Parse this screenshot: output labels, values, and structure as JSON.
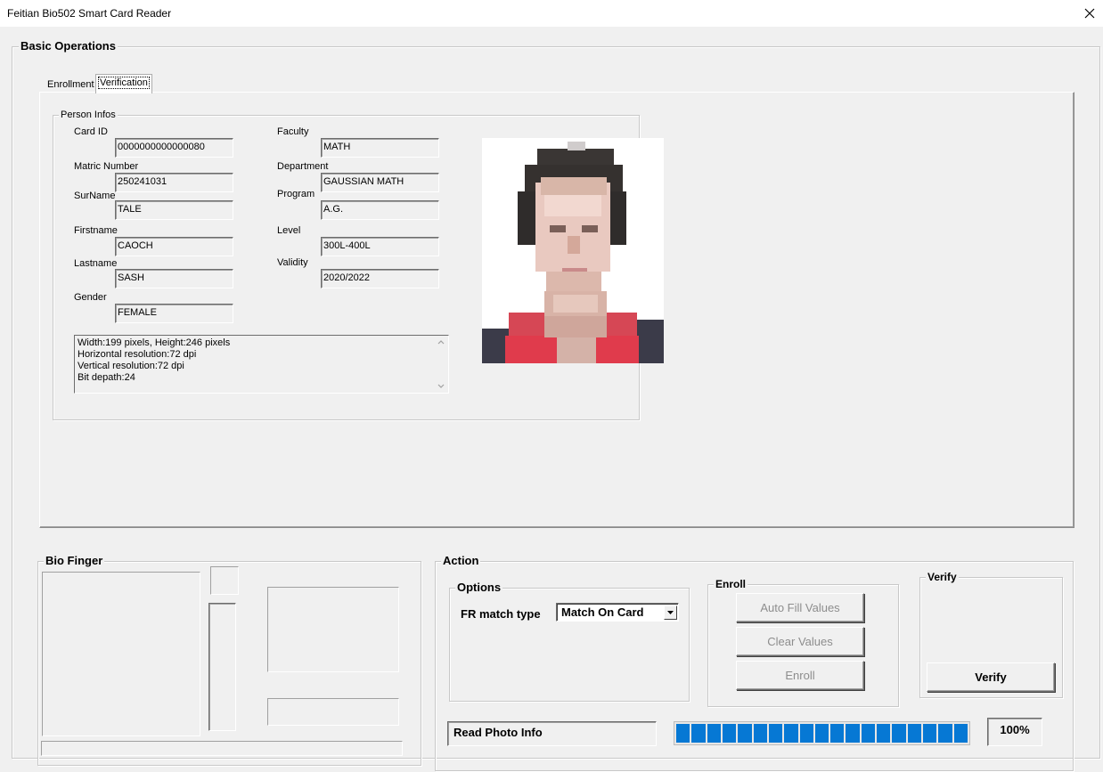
{
  "window": {
    "title": "Feitian Bio502 Smart Card Reader"
  },
  "basic_operations": {
    "legend": "Basic Operations",
    "tabs": [
      {
        "label": "Enrollment",
        "active": false
      },
      {
        "label": "Verification",
        "active": true
      }
    ]
  },
  "person_infos": {
    "legend": "Person Infos",
    "fields": {
      "card_id": {
        "label": "Card ID",
        "value": "0000000000000080"
      },
      "matric_number": {
        "label": "Matric Number",
        "value": "250241031"
      },
      "surname": {
        "label": "SurName",
        "value": "TALE"
      },
      "firstname": {
        "label": "Firstname",
        "value": "CAOCH"
      },
      "lastname": {
        "label": "Lastname",
        "value": "SASH"
      },
      "gender": {
        "label": "Gender",
        "value": "FEMALE"
      },
      "faculty": {
        "label": "Faculty",
        "value": "MATH"
      },
      "department": {
        "label": "Department",
        "value": "GAUSSIAN MATH"
      },
      "program": {
        "label": "Program",
        "value": "A.G."
      },
      "level": {
        "label": "Level",
        "value": "300L-400L"
      },
      "validity": {
        "label": "Validity",
        "value": "2020/2022"
      }
    },
    "image_info": [
      "Width:199 pixels, Height:246 pixels",
      "Horizontal resolution:72 dpi",
      "Vertical resolution:72 dpi",
      "Bit depath:24"
    ]
  },
  "bio_finger": {
    "legend": "Bio Finger"
  },
  "action": {
    "legend": "Action",
    "options": {
      "legend": "Options",
      "fr_match_type_label": "FR match type",
      "fr_match_type_value": "Match On Card"
    },
    "enroll": {
      "legend": "Enroll",
      "auto_fill_label": "Auto Fill Values",
      "clear_label": "Clear Values",
      "enroll_label": "Enroll"
    },
    "verify": {
      "legend": "Verify",
      "verify_label": "Verify"
    },
    "status_text": "Read Photo Info",
    "progress": {
      "value": 1.0,
      "label": "100%"
    }
  },
  "colors": {
    "progress": "#0678d4",
    "window_bg": "#f0f0f0"
  },
  "icons": {
    "close": "close-icon",
    "dropdown": "chevron-down-icon"
  }
}
